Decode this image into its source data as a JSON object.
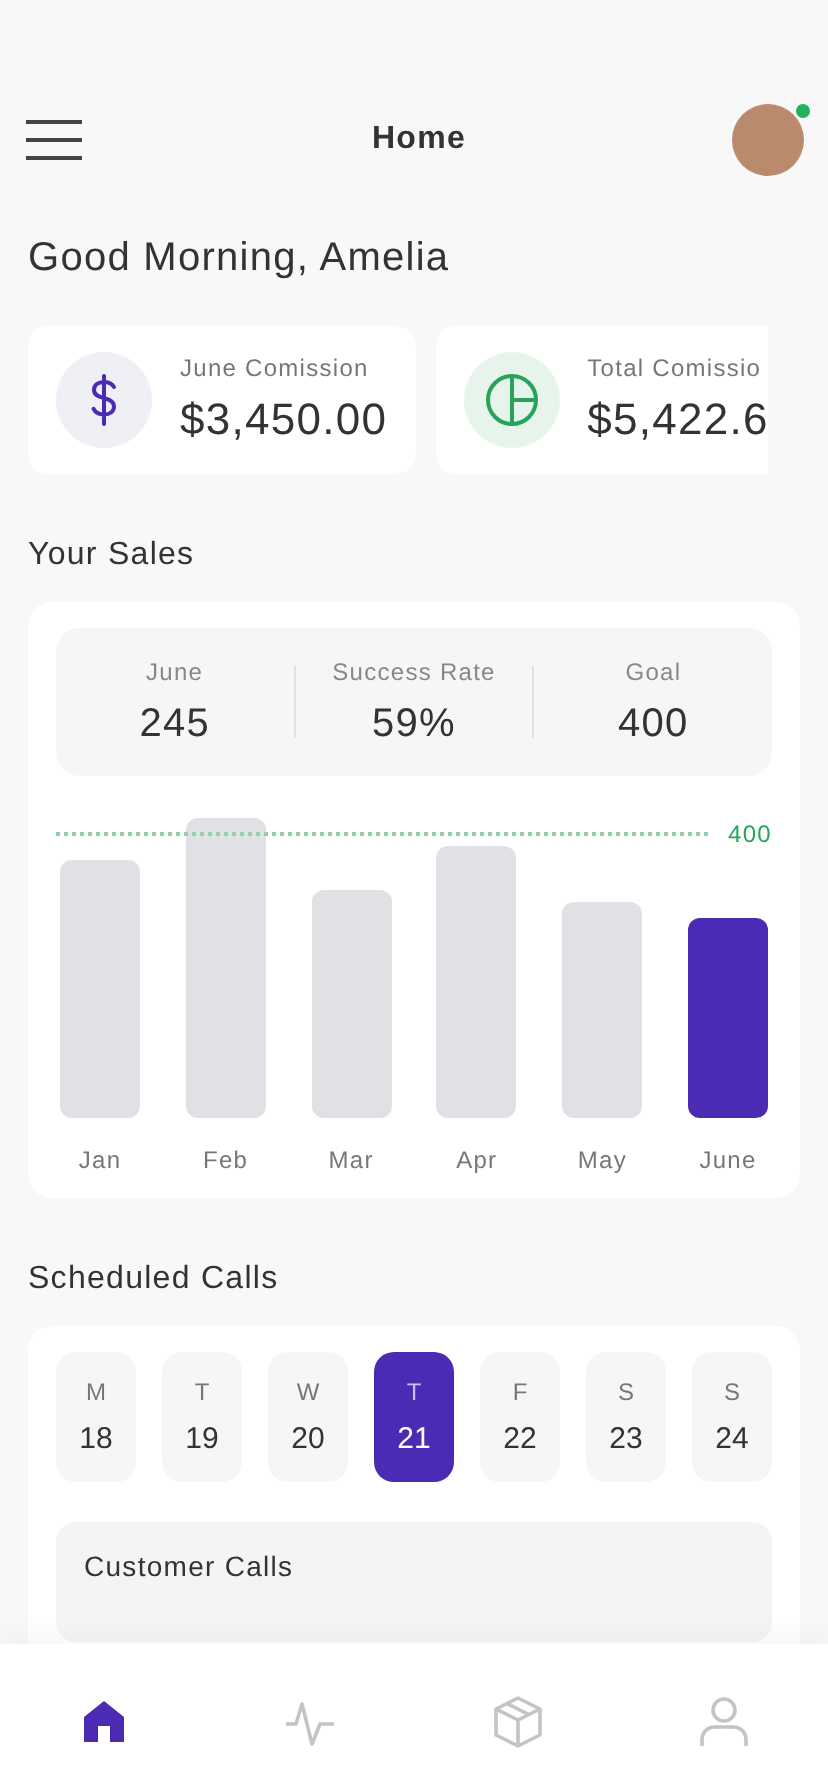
{
  "header": {
    "title": "Home",
    "avatar": {
      "online": true
    }
  },
  "greeting": "Good Morning, Amelia",
  "stat_cards": [
    {
      "kind": "dollar",
      "label": "June Comission",
      "value": "$3,450.00"
    },
    {
      "kind": "pie",
      "label": "Total Comissio",
      "value": "$5,422.6"
    }
  ],
  "sales": {
    "title": "Your Sales",
    "summary": [
      {
        "label": "June",
        "value": "245"
      },
      {
        "label": "Success Rate",
        "value": "59%"
      },
      {
        "label": "Goal",
        "value": "400"
      }
    ],
    "goal_label": "400",
    "months": [
      {
        "label": "Jan",
        "selected": false
      },
      {
        "label": "Feb",
        "selected": false
      },
      {
        "label": "Mar",
        "selected": false
      },
      {
        "label": "Apr",
        "selected": false
      },
      {
        "label": "May",
        "selected": false
      },
      {
        "label": "June",
        "selected": true
      }
    ]
  },
  "calls": {
    "title": "Scheduled Calls",
    "days": [
      {
        "weekday": "M",
        "date": "18",
        "selected": false
      },
      {
        "weekday": "T",
        "date": "19",
        "selected": false
      },
      {
        "weekday": "W",
        "date": "20",
        "selected": false
      },
      {
        "weekday": "T",
        "date": "21",
        "selected": true
      },
      {
        "weekday": "F",
        "date": "22",
        "selected": false
      },
      {
        "weekday": "S",
        "date": "23",
        "selected": false
      },
      {
        "weekday": "S",
        "date": "24",
        "selected": false
      }
    ],
    "section_title": "Customer Calls"
  },
  "tab_bar": [
    {
      "kind": "home",
      "selected": true
    },
    {
      "kind": "activity",
      "selected": false
    },
    {
      "kind": "box",
      "selected": false
    },
    {
      "kind": "profile",
      "selected": false
    }
  ]
}
